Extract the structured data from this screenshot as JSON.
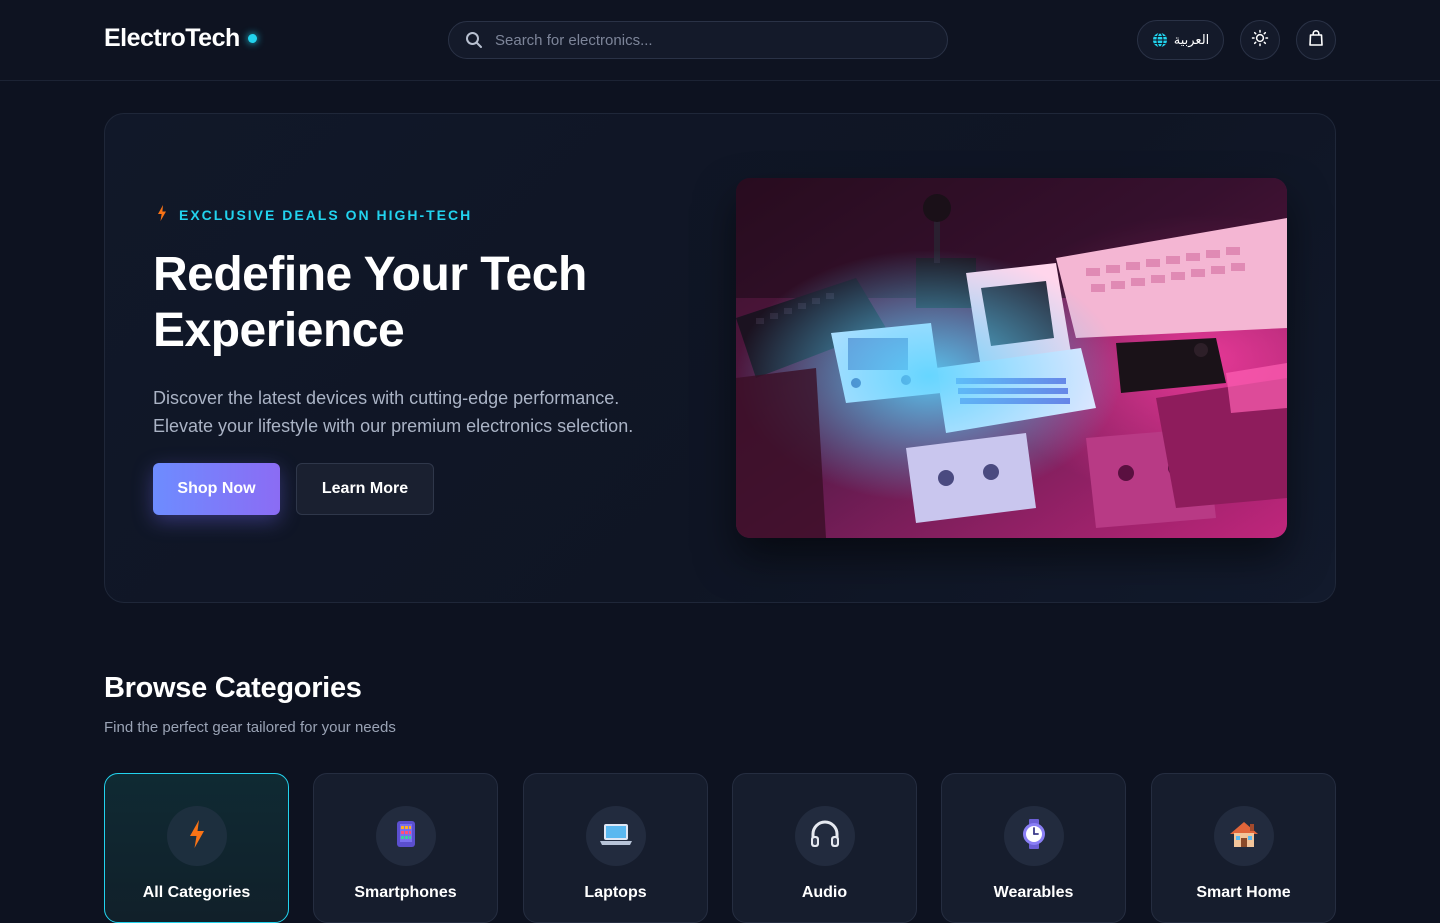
{
  "header": {
    "logo": "ElectroTech",
    "search_placeholder": "Search for electronics...",
    "language_label": "العربية"
  },
  "hero": {
    "eyebrow": "EXCLUSIVE DEALS ON HIGH-TECH",
    "title_line1": "Redefine Your Tech",
    "title_line2": "Experience",
    "description_line1": "Discover the latest devices with cutting-edge performance.",
    "description_line2": "Elevate your lifestyle with our premium electronics selection.",
    "primary_button": "Shop Now",
    "secondary_button": "Learn More"
  },
  "categories": {
    "title": "Browse Categories",
    "subtitle": "Find the perfect gear tailored for your needs",
    "items": [
      {
        "label": "All Categories",
        "icon": "lightning-icon",
        "active": true
      },
      {
        "label": "Smartphones",
        "icon": "smartphone-icon",
        "active": false
      },
      {
        "label": "Laptops",
        "icon": "laptop-icon",
        "active": false
      },
      {
        "label": "Audio",
        "icon": "headphones-icon",
        "active": false
      },
      {
        "label": "Wearables",
        "icon": "watch-icon",
        "active": false
      },
      {
        "label": "Smart Home",
        "icon": "house-icon",
        "active": false
      }
    ]
  },
  "colors": {
    "background": "#0d1220",
    "accent_cyan": "#22d3ee",
    "primary_gradient_start": "#6d8cff",
    "primary_gradient_end": "#8b6cf4"
  }
}
